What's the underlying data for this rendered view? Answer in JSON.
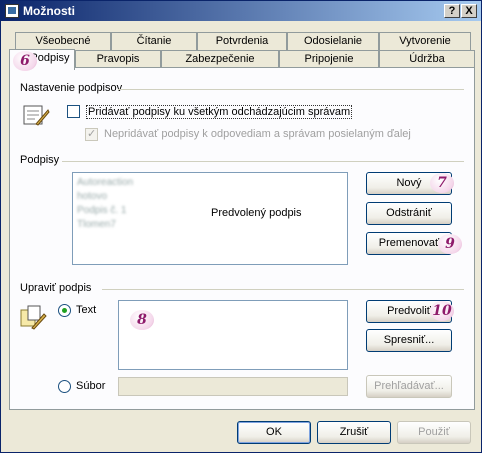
{
  "window": {
    "title": "Možnosti",
    "help_button": "?",
    "close_button": "X"
  },
  "tabs_row1": [
    "Všeobecné",
    "Čítanie",
    "Potvrdenia",
    "Odosielanie",
    "Vytvorenie"
  ],
  "tabs_row2": [
    "Podpisy",
    "Pravopis",
    "Zabezpečenie",
    "Pripojenie",
    "Údržba"
  ],
  "active_tab": "Podpisy",
  "settings_group": {
    "title": "Nastavenie podpisov",
    "add_signature_checkbox": "Pridávať podpisy ku všetkým odchádzajúcim správam",
    "no_reply_checkbox": "Nepridávať podpisy k odpovediam a správam posielaným ďalej"
  },
  "signatures_group": {
    "title": "Podpisy",
    "items": [
      "Autoreaction",
      "hotovo",
      "Podpis č. 1",
      "Tlomen7"
    ],
    "default_label": "Predvolený podpis",
    "new_button": "Nový",
    "remove_button": "Odstrániť",
    "rename_button": "Premenovať"
  },
  "edit_group": {
    "title": "Upraviť podpis",
    "text_radio": "Text",
    "file_radio": "Súbor",
    "default_button": "Predvoliť",
    "advanced_button": "Spresniť...",
    "browse_button": "Prehľadávať..."
  },
  "footer": {
    "ok": "OK",
    "cancel": "Zrušiť",
    "apply": "Použiť"
  },
  "badges": {
    "b6": "6",
    "b7": "7",
    "b8": "8",
    "b9": "9",
    "b10": "10"
  }
}
